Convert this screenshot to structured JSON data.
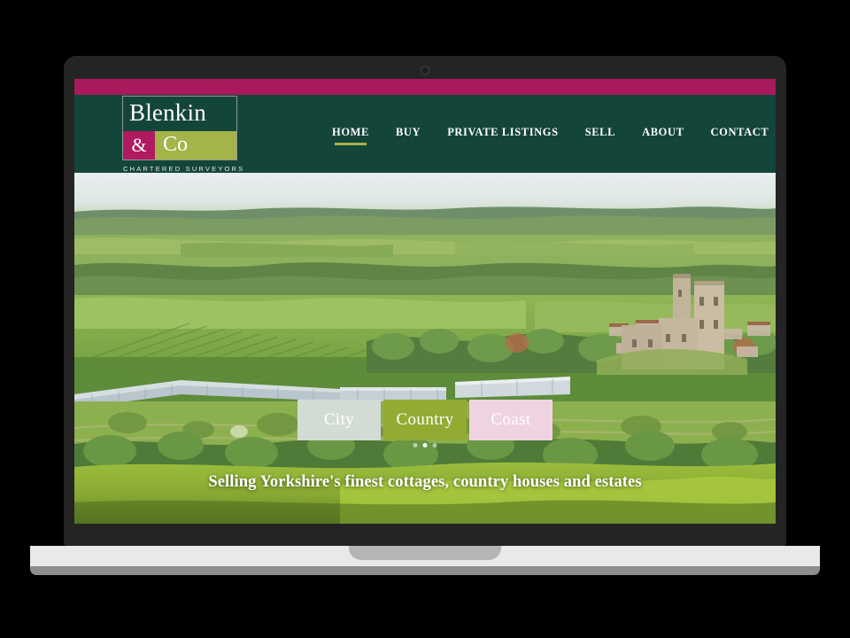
{
  "device": {
    "type": "laptop-mockup",
    "webcam": "webcam-icon"
  },
  "site": {
    "brand": {
      "name_line1": "Blenkin",
      "ampersand": "&",
      "name_line2": "Co",
      "tagline": "CHARTERED SURVEYORS"
    },
    "nav": {
      "items": [
        {
          "label": "HOME",
          "active": true
        },
        {
          "label": "BUY",
          "active": false
        },
        {
          "label": "PRIVATE LISTINGS",
          "active": false
        },
        {
          "label": "SELL",
          "active": false
        },
        {
          "label": "ABOUT",
          "active": false
        },
        {
          "label": "CONTACT",
          "active": false
        }
      ]
    },
    "hero": {
      "tabs": [
        {
          "label": "City",
          "color": "#d3dcd4"
        },
        {
          "label": "Country",
          "color": "#93ab32"
        },
        {
          "label": "Coast",
          "color": "#f0d3e1"
        }
      ],
      "slider_dots": [
        {
          "active": false
        },
        {
          "active": true
        },
        {
          "active": false
        }
      ],
      "tagline": "Selling Yorkshire's finest cottages, country houses and estates",
      "image_description": "Aerial view of Helmsley, North Yorkshire — castle ruins, walled garden glasshouses, patchwork fields and woodland"
    },
    "colors": {
      "magenta_bar": "#a81a5c",
      "header_green": "#14453a",
      "logo_olive": "#a4b449",
      "logo_magenta": "#b01a5f",
      "accent_underline": "#a4b449"
    }
  }
}
